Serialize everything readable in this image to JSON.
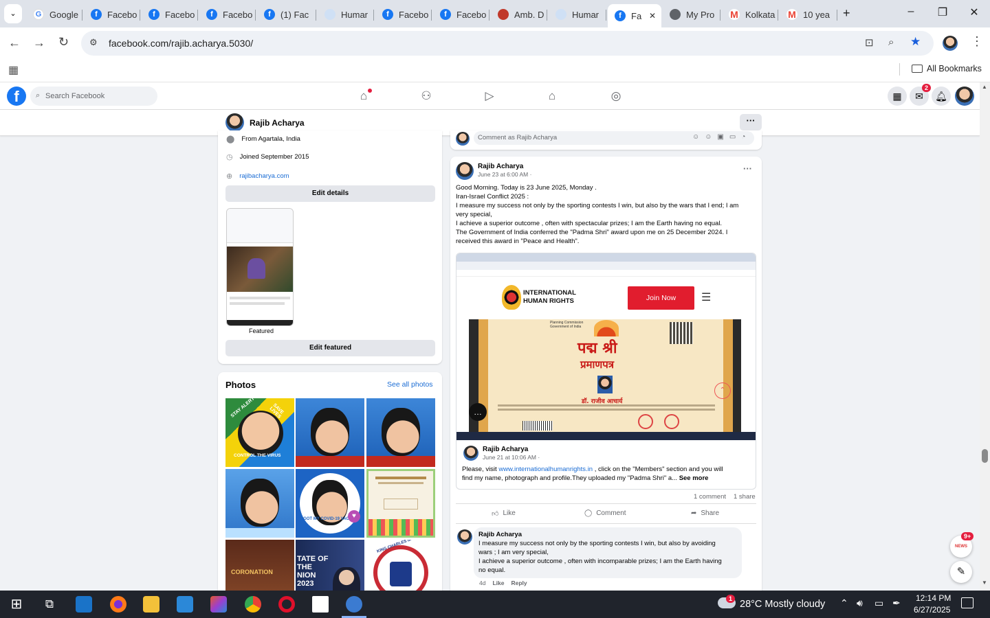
{
  "tabs": [
    {
      "title": "Google",
      "icon": "g"
    },
    {
      "title": "Facebo",
      "icon": "fb"
    },
    {
      "title": "Facebo",
      "icon": "fb"
    },
    {
      "title": "Facebo",
      "icon": "fb"
    },
    {
      "title": "(1) Fac",
      "icon": "fb"
    },
    {
      "title": "Humar",
      "icon": "hr"
    },
    {
      "title": "Facebo",
      "icon": "fb"
    },
    {
      "title": "Facebo",
      "icon": "fb"
    },
    {
      "title": "Amb. D",
      "icon": "amb"
    },
    {
      "title": "Humar",
      "icon": "hr"
    },
    {
      "title": "Fa",
      "icon": "fb",
      "active": true
    },
    {
      "title": "My Pro",
      "icon": "pr"
    },
    {
      "title": "Kolkata",
      "icon": "gm"
    },
    {
      "title": "10 yea",
      "icon": "gm"
    }
  ],
  "browser": {
    "url": "facebook.com/rajib.acharya.5030/",
    "bookmarks_label": "All Bookmarks"
  },
  "fb": {
    "search_placeholder": "Search Facebook",
    "messenger_badge": "2",
    "profile_name": "Rajib Acharya"
  },
  "intro": {
    "from": "From Agartala, India",
    "joined": "Joined September 2015",
    "website": "rajibacharya.com",
    "edit_details": "Edit details",
    "featured_label": "Featured",
    "edit_featured": "Edit featured"
  },
  "photos": {
    "title": "Photos",
    "see_all": "See all photos",
    "captions": [
      "STAY ALERT",
      "SAVE LIVES",
      "CONTROL THE VIRUS",
      "I GOT MY COVID-19 VACCINE",
      "CORONATION",
      "TATE OF THE NION 2023",
      "KING CHARLES III"
    ]
  },
  "comment_box": {
    "placeholder": "Comment as Rajib Acharya"
  },
  "post": {
    "author": "Rajib Acharya",
    "time": "June 23 at 6:00 AM ·",
    "lines": [
      "Good Morning. Today is 23 June 2025, Monday .",
      "Iran-Israel Conflict 2025 :",
      "I measure my success not only by the sporting contests I win, but also by the wars that I end; I am",
      "very special,",
      "I achieve a superior outcome , often with spectacular prizes; I am the Earth having no equal.",
      "The Government of India conferred the \"Padma Shri\" award upon me on 25 December 2024. I",
      "received this award in \"Peace and Health\"."
    ],
    "embed": {
      "org_line1": "INTERNATIONAL",
      "org_line2": "HUMAN  RIGHTS",
      "join_now": "Join Now",
      "cert_title": "पद्म श्री",
      "cert_sub": "प्रमाणपत्र",
      "cert_name": "डॉ. राजीव आचार्य",
      "cert_head1": "Planning Commission",
      "cert_head2": "Government of India"
    },
    "shared": {
      "author": "Rajib Acharya",
      "time": "June 21 at 10:06 AM ·",
      "text_before": "Please, visit",
      "link": "www.internationalhumanrights.in",
      "text_after": ", click on the \"Members\" section and you will",
      "line2": "find my name, photograph and profile.They uploaded my \"Padma Shri\" a...",
      "see_more": "See more"
    },
    "comments_count": "1 comment",
    "shares_count": "1 share",
    "actions": {
      "like": "Like",
      "comment": "Comment",
      "share": "Share"
    },
    "comment": {
      "author": "Rajib Acharya",
      "lines": [
        "I measure my success not only by the sporting contests I win, but also by avoiding",
        "wars ; I am very special,",
        "I achieve a superior outcome , often with incomparable prizes; I am the Earth having",
        "no equal."
      ],
      "age": "4d",
      "like": "Like",
      "reply": "Reply"
    }
  },
  "news_badge": "9+",
  "news_label": "NEWS",
  "taskbar": {
    "weather": "28°C  Mostly cloudy",
    "weather_badge": "1",
    "time": "12:14 PM",
    "date": "6/27/2025"
  }
}
